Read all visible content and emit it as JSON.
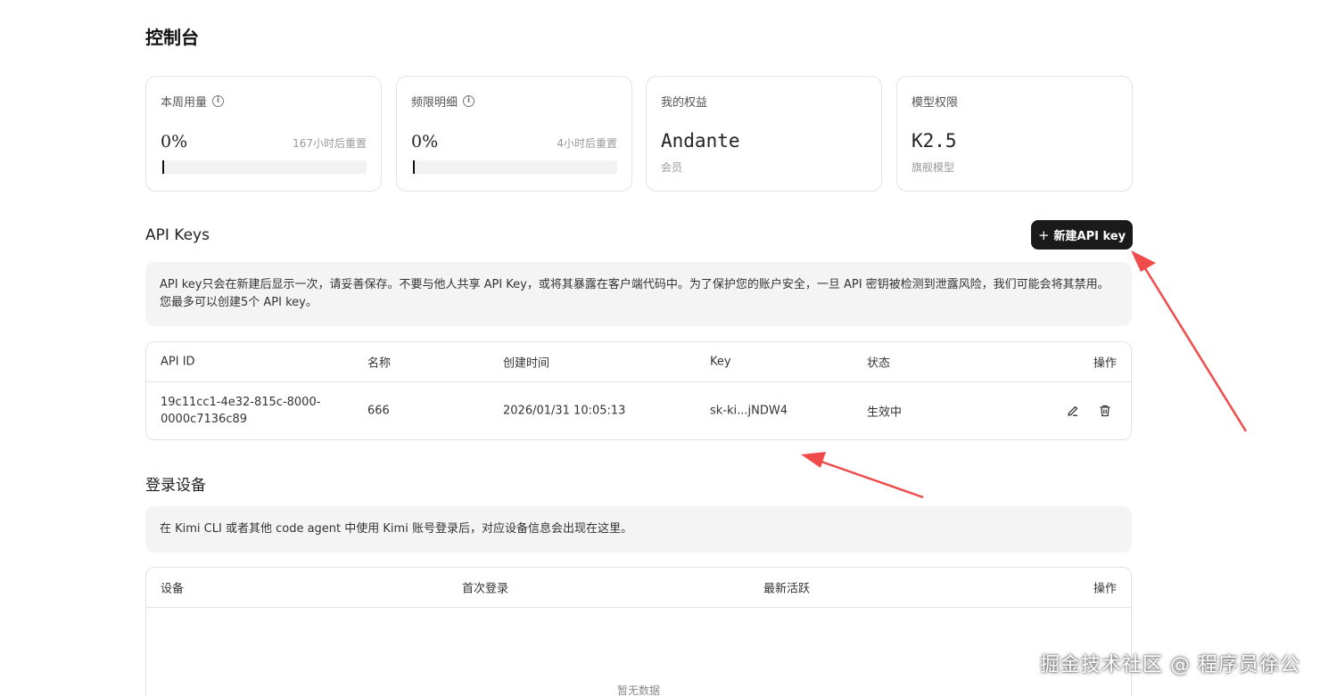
{
  "page": {
    "title": "控制台"
  },
  "stats": {
    "weekly": {
      "label": "本周用量",
      "value": "0%",
      "reset": "167小时后重置",
      "progress": 0
    },
    "rate": {
      "label": "频限明细",
      "value": "0%",
      "reset": "4小时后重置",
      "progress": 0
    },
    "plan": {
      "label": "我的权益",
      "value": "Andante",
      "sub": "会员"
    },
    "model": {
      "label": "模型权限",
      "value": "K2.5",
      "sub": "旗舰模型"
    }
  },
  "api_keys": {
    "title": "API Keys",
    "new_button": "新建API key",
    "notice": "API key只会在新建后显示一次，请妥善保存。不要与他人共享 API Key，或将其暴露在客户端代码中。为了保护您的账户安全，一旦 API 密钥被检测到泄露风险，我们可能会将其禁用。您最多可以创建5个 API key。",
    "columns": [
      "API ID",
      "名称",
      "创建时间",
      "Key",
      "状态",
      "操作"
    ],
    "rows": [
      {
        "id": "19c11cc1-4e32-815c-8000-0000c7136c89",
        "name": "666",
        "created": "2026/01/31 10:05:13",
        "key": "sk-ki...jNDW4",
        "status": "生效中"
      }
    ]
  },
  "devices": {
    "title": "登录设备",
    "notice": "在 Kimi CLI 或者其他 code agent 中使用 Kimi 账号登录后，对应设备信息会出现在这里。",
    "columns": [
      "设备",
      "首次登录",
      "最新活跃",
      "操作"
    ],
    "empty": "暂无数据"
  },
  "watermark": "掘金技术社区 @ 程序员徐公",
  "colors": {
    "accent": "#1a1a1a",
    "arrow": "#ef4b4b",
    "panel": "#f4f4f4"
  }
}
